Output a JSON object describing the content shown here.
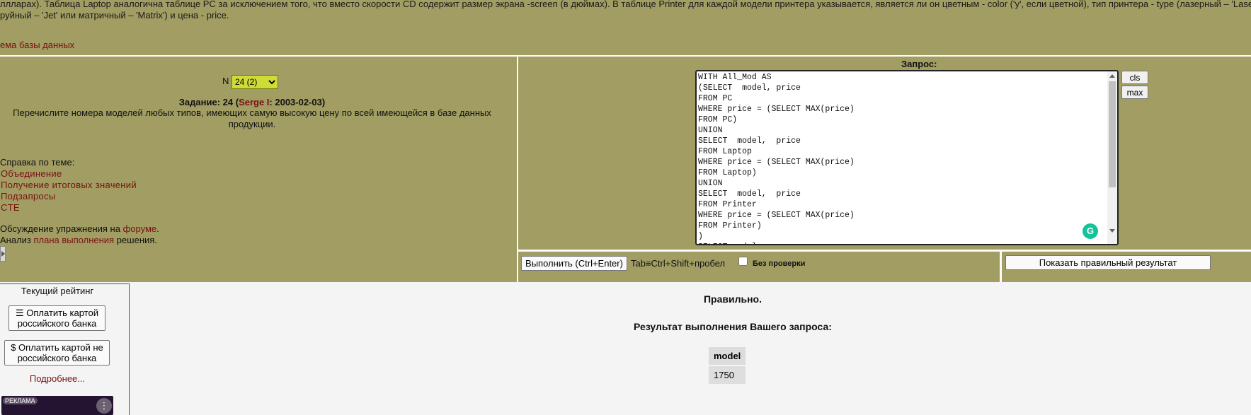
{
  "intro": {
    "line1": "ллларах). Таблица Laptop аналогична таблице PC за исключением того, что вместо скорости CD содержит размер экрана -screen (в дюймах). В таблице Printer для каждой модели принтера указывается, является ли он цветным - color ('y', если цветной), тип принтера - type (лазерный – 'Laser', стр",
    "line2": "руйный – 'Jet' или матричный – 'Matrix') и цена - price.",
    "schema_link": "ема базы данных"
  },
  "task": {
    "n_label": "N",
    "n_selected": "24 (2)",
    "title_prefix": "Задание: 24 (",
    "author": "Serge I",
    "title_suffix": ": 2003-02-03)",
    "text": "Перечислите номера моделей любых типов, имеющих самую высокую цену по всей имеющейся в базе данных продукции."
  },
  "help": {
    "title": "Справка по теме:",
    "links": [
      "Объединение",
      "Получение итоговых значений",
      "Подзапросы",
      "CTE"
    ]
  },
  "forum": {
    "prefix": "Обсуждение упражнения на ",
    "link": "форуме",
    "suffix": "."
  },
  "plan": {
    "prefix": "Анализ ",
    "link": "плана выполнения",
    "suffix": " решения."
  },
  "query": {
    "label": "Запрос:",
    "text": "WITH All_Mod AS\n(SELECT  model, price\nFROM PC\nWHERE price = (SELECT MAX(price)\nFROM PC)\nUNION\nSELECT  model,  price\nFROM Laptop\nWHERE price = (SELECT MAX(price)\nFROM Laptop)\nUNION\nSELECT  model,  price\nFROM Printer\nWHERE price = (SELECT MAX(price)\nFROM Printer)\n)\nSELECT model",
    "cls_label": "cls",
    "max_label": "max",
    "grammarly_icon": "G"
  },
  "execute": {
    "button_label": "Выполнить (Ctrl+Enter)",
    "tab_hint": "Tab≡Ctrl+Shift+пробел",
    "nocheck_label": "Без  проверки",
    "show_result_label": "Показать правильный результат"
  },
  "rating": {
    "title": "Текущий рейтинг",
    "pay_russian": "☰ Оплатить картой российского банка",
    "pay_foreign": "$ Оплатить картой не российского банка",
    "more": "Подробнее..."
  },
  "ad": {
    "label": "РЕКЛАМА",
    "menu_icon": "⋮"
  },
  "result": {
    "status": "Правильно.",
    "title": "Результат выполнения Вашего запроса:",
    "columns": [
      "model"
    ],
    "rows": [
      [
        "1750"
      ]
    ]
  },
  "colors": {
    "panel_olive": "#a19d63",
    "link_red": "#7a1010",
    "select_green": "#cfdc37"
  }
}
